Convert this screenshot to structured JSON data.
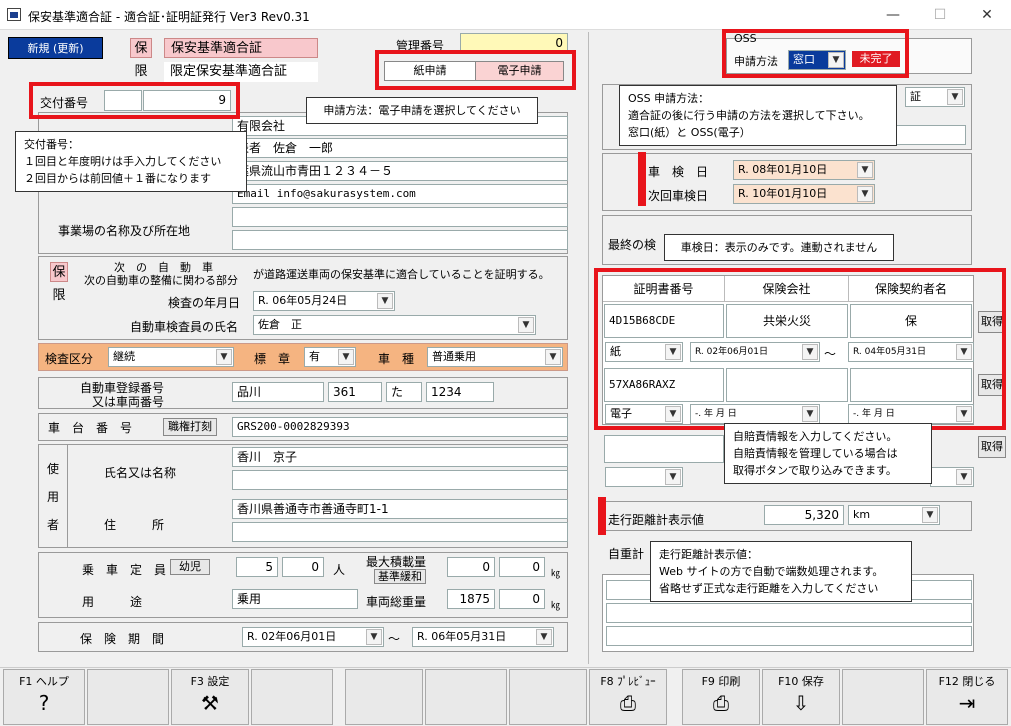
{
  "window": {
    "title": "保安基準適合証 - 適合証･証明証発行 Ver3 Rev0.31",
    "minimize": "—",
    "maximize": "☐",
    "close": "✕"
  },
  "header": {
    "new_button": "新規 (更新)",
    "ho": "保",
    "gen": "限",
    "hoan_label": "保安基準適合証",
    "gentei_label": "限定保安基準適合証",
    "kanri_label": "管理番号",
    "kanri_value": "0",
    "paper_btn": "紙申請",
    "electronic_btn": "電子申請"
  },
  "koufu": {
    "label": "交付番号",
    "value": "9"
  },
  "oss": {
    "group": "OSS",
    "method_label": "申請方法",
    "method_value": "窓口",
    "status": "未完了"
  },
  "callouts": {
    "koufu": [
      "交付番号：",
      "１回目と年度明けは手入力してください",
      "２回目からは前回値＋１番になります"
    ],
    "method": "申請方法：電子申請を選択してください",
    "oss": [
      "OSS 申請方法：",
      "適合証の後に行う申請の方法を選択して下さい。",
      "窓口(紙）と OSS(電子）"
    ],
    "shaken": "車検日：表示のみです。連動されません",
    "jibai": [
      "自賠責情報を入力してください。",
      "自賠責情報を管理している場合は",
      "取得ボタンで取り込みできます。"
    ],
    "odometer": [
      "走行距離計表示値：",
      "Web サイトの方で自動で端数処理されます。",
      "省略せず正式な走行距離を入力してください"
    ]
  },
  "company": {
    "name": "有限会社",
    "rep": "表者　佐倉　一郎",
    "addr": "葉県流山市青田１２３４－５",
    "email": "Email info@sakurasystem.com",
    "jigyo_label": "事業場の名称及び所在地",
    "shou_select": "証"
  },
  "cert": {
    "ho": "保",
    "gen": "限",
    "tsugi_line1": "次　の　自　動　車",
    "tsugi_line2": "次の自動車の整備に関わる部分",
    "sentence": "が道路運送車両の保安基準に適合していることを証明する。",
    "kensa_label": "検査の年月日",
    "kensa_date": "R. 06年05月24日",
    "inspector_label": "自動車検査員の氏名",
    "inspector": "佐倉　正"
  },
  "inspect_row": {
    "kubun_label": "検査区分",
    "kubun": "継続",
    "hyosho_label": "標　章",
    "hyosho": "有",
    "shashu_label": "車　種",
    "shashu": "普通乗用"
  },
  "vehicle": {
    "reg_label1": "自動車登録番号",
    "reg_label2": "又は車両番号",
    "reg1": "品川",
    "reg2": "361",
    "reg3": "た",
    "reg4": "1234",
    "chassis_label": "車　台　番　号",
    "chassis_btn": "職権打刻",
    "chassis": "GRS200-0002829393",
    "user_label": "使用者",
    "user_chars": [
      "使",
      "用",
      "者"
    ],
    "name_label": "氏名又は名称",
    "name": "香川　京子",
    "addr_label": "住　　　所",
    "addr": "香川県善通寺市善通寺町1-1",
    "capacity_label": "乗　車　定　員",
    "youji_btn": "幼児",
    "cap1": "5",
    "cap2": "0",
    "cap_unit": "人",
    "load_label": "最大積載量",
    "kijun_btn": "基準緩和",
    "load1": "0",
    "load2": "0",
    "kg": "㎏",
    "youto_label": "用　　　途",
    "youto": "乗用",
    "weight_label": "車両総重量",
    "weight1": "1875",
    "weight2": "0",
    "hoken_label": "保　険　期　間",
    "hoken_from": "R. 02年06月01日",
    "tilde": "〜",
    "hoken_to": "R. 06年05月31日"
  },
  "shaken": {
    "label1": "車　検　日",
    "date1": "R. 08年01月10日",
    "label2": "次回車検日",
    "date2": "R. 10年01月10日",
    "saishu": "最終の検"
  },
  "jibai": {
    "headers": [
      "証明書番号",
      "保険会社",
      "保険契約者名"
    ],
    "row1": {
      "no": "4D15B68CDE",
      "company": "共栄火災",
      "holder": "保",
      "type": "紙",
      "from": "R. 02年06月01日",
      "to": "R. 04年05月31日"
    },
    "row2": {
      "no": "57XA86RAXZ",
      "company": "",
      "holder": "",
      "type": "電子",
      "from": "-. 年 月 日",
      "to": "-. 年 月 日"
    },
    "get_btn": "取得"
  },
  "odometer": {
    "label": "走行距離計表示値",
    "value": "5,320",
    "unit": "km",
    "jiju": "自重計"
  },
  "fkeys": [
    {
      "label": "F1 ヘルプ",
      "icon": "?"
    },
    {
      "label": "F3 設定",
      "icon": "⚒"
    },
    {
      "label": "F8 ﾌﾟﾚﾋﾞｭｰ",
      "icon": "⎙"
    },
    {
      "label": "F9 印刷",
      "icon": "⎙"
    },
    {
      "label": "F10 保存",
      "icon": "⇩"
    },
    {
      "label": "F12 閉じる",
      "icon": "⇥"
    }
  ],
  "colors": {
    "accent_blue": "#0a3b9c",
    "red": "#e8141b",
    "orange": "#f5b481"
  }
}
